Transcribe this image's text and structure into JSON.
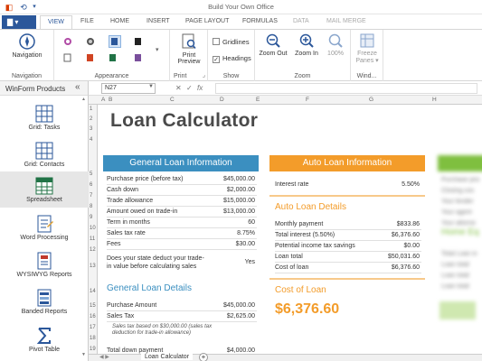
{
  "window": {
    "title": "Build Your Own Office"
  },
  "ribbon_tabs": {
    "menu_label": "▾",
    "tabs": [
      "VIEW",
      "FILE",
      "HOME",
      "INSERT",
      "PAGE LAYOUT",
      "FORMULAS",
      "DATA",
      "MAIL MERGE"
    ],
    "active": "VIEW"
  },
  "ribbon": {
    "navigation": {
      "button": "Navigation",
      "group": "Navigation"
    },
    "appearance": {
      "group": "Appearance"
    },
    "print": {
      "button_line1": "Print",
      "button_line2": "Preview",
      "group": "Print"
    },
    "show": {
      "gridlines": "Gridlines",
      "headings": "Headings",
      "group": "Show"
    },
    "zoom": {
      "zoom_out": "Zoom Out",
      "zoom_in": "Zoom In",
      "zoom_100": "100%",
      "group": "Zoom"
    },
    "window": {
      "freeze_line1": "Freeze",
      "freeze_line2": "Panes ▾",
      "group": "Wind..."
    }
  },
  "nav_panel": {
    "title": "WinForm Products",
    "collapse": "«",
    "items": [
      {
        "label": "Grid: Tasks",
        "icon": "grid-icon"
      },
      {
        "label": "Grid: Contacts",
        "icon": "grid-icon"
      },
      {
        "label": "Spreadsheet",
        "icon": "spreadsheet-icon",
        "active": true
      },
      {
        "label": "Word Processing",
        "icon": "word-processing-icon"
      },
      {
        "label": "WYSIWYG Reports",
        "icon": "report-icon"
      },
      {
        "label": "Banded Reports",
        "icon": "report-icon"
      },
      {
        "label": "Pivot Table",
        "icon": "sum-icon"
      }
    ]
  },
  "formula_bar": {
    "name_box": "N27",
    "cancel": "✕",
    "enter": "✓",
    "fx": "fx"
  },
  "sheet": {
    "columns": [
      "A",
      "B",
      "C",
      "D",
      "E",
      "F",
      "G",
      "H"
    ],
    "rows": [
      "1",
      "2",
      "3",
      "4",
      "5",
      "6",
      "7",
      "8",
      "9",
      "10",
      "11",
      "12",
      "13",
      "14",
      "15",
      "16",
      "17",
      "18",
      "19",
      "20"
    ],
    "title": "Loan Calculator",
    "general_header": "General Loan Information",
    "general_rows": [
      {
        "label": "Purchase price (before tax)",
        "value": "$45,000.00"
      },
      {
        "label": "Cash down",
        "value": "$2,000.00"
      },
      {
        "label": "Trade allowance",
        "value": "$15,000.00"
      },
      {
        "label": "Amount owed on trade-in",
        "value": "$13,000.00"
      },
      {
        "label": "Term in months",
        "value": "60"
      },
      {
        "label": "Sales tax rate",
        "value": "8.75%"
      },
      {
        "label": "Fees",
        "value": "$30.00"
      }
    ],
    "deduct_line1": "Does your state deduct your trade-",
    "deduct_line2": "in value before calculating sales",
    "deduct_value": "Yes",
    "general_details_title": "General Loan Details",
    "details_rows": [
      {
        "label": "Purchase Amount",
        "value": "$45,000.00"
      },
      {
        "label": "Sales Tax",
        "value": "$2,625.00"
      }
    ],
    "sales_tax_note_line1": "Sales tax based on $30,000.00 (sales tax",
    "sales_tax_note_line2": "deduction for trade-in allowance)",
    "total_down_label": "Total down payment",
    "total_down_value": "$4,000.00",
    "auto_header": "Auto Loan Information",
    "interest_label": "Interest rate",
    "interest_value": "5.50%",
    "auto_details_title": "Auto Loan Details",
    "auto_rows": [
      {
        "label": "Monthly payment",
        "value": "$833.86"
      },
      {
        "label": "Total interest (5.50%)",
        "value": "$6,376.60"
      },
      {
        "label": "Potential income tax savings",
        "value": "$0.00"
      },
      {
        "label": "Loan total",
        "value": "$50,031.60"
      },
      {
        "label": "Cost of loan",
        "value": "$6,376.60"
      }
    ],
    "cost_title": "Cost of Loan",
    "cost_value": "$6,376.60",
    "blur_right": {
      "rows": [
        "Purchase pric",
        "Closing cos",
        "Your lender",
        "Your agent",
        "Your attorne"
      ],
      "title": "Home Eq",
      "rows2": [
        "Total Loan in",
        "Loan total",
        "Loan total",
        "Loan total"
      ]
    },
    "sheet_tab": "Loan Calculator",
    "add_sheet": "+"
  },
  "colors": {
    "blue": "#3b8fc0",
    "orange": "#f39c2a",
    "green": "#7fbf3f",
    "office_blue": "#2b579a"
  }
}
